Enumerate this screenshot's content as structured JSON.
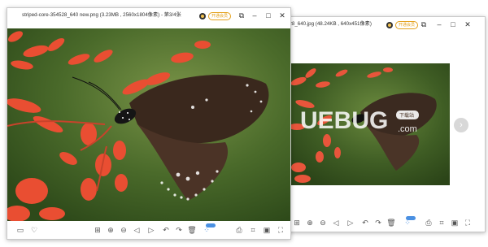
{
  "front_window": {
    "title": "striped-core-354528_640 new.png (3.23MB , 2560x1804像素) - 第3/4张",
    "vip_label": "开通会员"
  },
  "back_window": {
    "title": "528_640.jpg (48.24KB , 640x451像素)",
    "vip_label": "开通会员",
    "watermark": {
      "text": "UEBUG",
      "dotcom": ".com",
      "tag": "下载站"
    }
  },
  "icons": {
    "folder": "folder-icon",
    "heart": "heart-icon",
    "zoom_in": "zoom-in-icon",
    "zoom_out": "zoom-out-icon",
    "prev": "prev-icon",
    "next": "next-icon",
    "rotate_left": "rotate-left-icon",
    "rotate_right": "rotate-right-icon",
    "delete": "trash-icon",
    "print": "print-icon",
    "fullscreen": "fullscreen-icon",
    "minimize": "minimize-icon",
    "maximize": "maximize-icon",
    "close": "close-icon",
    "pin": "pin-icon"
  },
  "colors": {
    "accent": "#4a90e2",
    "vip": "#e4a01a",
    "arrow_bg": "#d8d8d8"
  }
}
